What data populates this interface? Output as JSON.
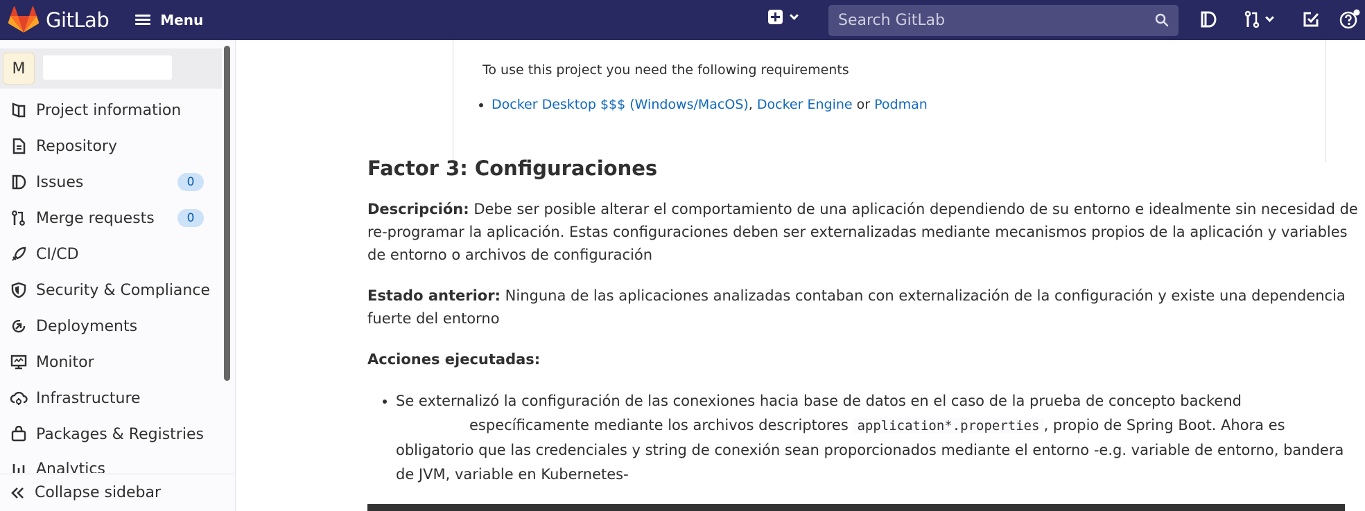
{
  "topbar": {
    "brand": "GitLab",
    "menu_label": "Menu",
    "search_placeholder": "Search GitLab"
  },
  "sidebar": {
    "avatar_letter": "M",
    "items": [
      {
        "label": "Project information",
        "icon": "project-icon"
      },
      {
        "label": "Repository",
        "icon": "document-icon"
      },
      {
        "label": "Issues",
        "icon": "issues-icon",
        "badge": "0"
      },
      {
        "label": "Merge requests",
        "icon": "merge-request-icon",
        "badge": "0"
      },
      {
        "label": "CI/CD",
        "icon": "rocket-icon"
      },
      {
        "label": "Security & Compliance",
        "icon": "shield-icon"
      },
      {
        "label": "Deployments",
        "icon": "deployments-icon"
      },
      {
        "label": "Monitor",
        "icon": "monitor-icon"
      },
      {
        "label": "Infrastructure",
        "icon": "cloud-icon"
      },
      {
        "label": "Packages & Registries",
        "icon": "package-icon"
      },
      {
        "label": "Analytics",
        "icon": "chart-icon"
      }
    ],
    "collapse_label": "Collapse sidebar"
  },
  "content": {
    "requirements_text": "To use this project you need the following requirements",
    "links": {
      "docker_desktop": "Docker Desktop $$$ (Windows/MacOS)",
      "comma": ",",
      "docker_engine": "Docker Engine",
      "or": "or",
      "podman": "Podman"
    },
    "heading": "Factor 3: Configuraciones",
    "descripcion_label": "Descripción:",
    "descripcion_text": "Debe ser posible alterar el comportamiento de una aplicación dependiendo de su entorno e idealmente sin necesidad de re-programar la aplicación. Estas configuraciones deben ser externalizadas mediante mecanismos propios de la aplicación y variables de entorno o archivos de configuración",
    "estado_label": "Estado anterior:",
    "estado_text": "Ninguna de las aplicaciones analizadas contaban con externalización de la configuración y existe una dependencia fuerte del entorno",
    "acciones_label": "Acciones ejecutadas:",
    "bullet_part1": "Se externalizó la configuración de las conexiones hacia base de datos en el caso de la prueba de concepto backend",
    "bullet_part2": "específicamente mediante los archivos descriptores",
    "bullet_code": "application*.properties",
    "bullet_part3": ", propio de Spring Boot. Ahora es obligatorio que las credenciales y string de conexión sean proporcionados mediante el entorno -e.g. variable de entorno, bandera de JVM, variable en Kubernetes-"
  }
}
